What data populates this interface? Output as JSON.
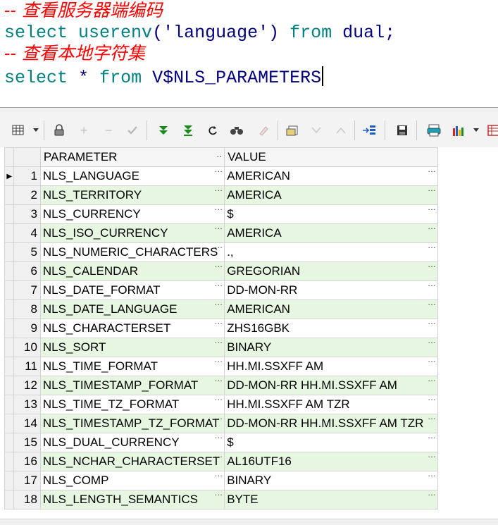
{
  "editor": {
    "comment1": "-- 查看服务器端编码",
    "line2": {
      "kw1": "select",
      "fn": "userenv",
      "arg": "'language'",
      "kw2": "from",
      "obj": "dual;"
    },
    "comment2": "-- 查看本地字符集",
    "line4": {
      "kw1": "select",
      "star": "*",
      "kw2": "from",
      "obj": "V$NLS_PARAMETERS"
    }
  },
  "toolbar": {
    "icons": [
      "grid-menu-icon",
      "lock-icon",
      "plus-icon",
      "minus-icon",
      "check-icon",
      "fetch-next-icon",
      "fetch-all-icon",
      "refresh-icon",
      "find-icon",
      "clear-icon",
      "query-by-example-icon",
      "filter-down-icon",
      "filter-up-icon",
      "export-icon",
      "save-icon",
      "print-icon",
      "chart-icon",
      "table-icon"
    ],
    "colors": {
      "green": "#1a8a1a",
      "blue": "#1f5fbf",
      "gray": "#b0b0b0"
    }
  },
  "grid": {
    "columns": [
      "PARAMETER",
      "VALUE"
    ],
    "rows": [
      {
        "n": "1",
        "param": "NLS_LANGUAGE",
        "value": "AMERICAN"
      },
      {
        "n": "2",
        "param": "NLS_TERRITORY",
        "value": "AMERICA"
      },
      {
        "n": "3",
        "param": "NLS_CURRENCY",
        "value": "$"
      },
      {
        "n": "4",
        "param": "NLS_ISO_CURRENCY",
        "value": "AMERICA"
      },
      {
        "n": "5",
        "param": "NLS_NUMERIC_CHARACTERS",
        "value": ".,"
      },
      {
        "n": "6",
        "param": "NLS_CALENDAR",
        "value": "GREGORIAN"
      },
      {
        "n": "7",
        "param": "NLS_DATE_FORMAT",
        "value": "DD-MON-RR"
      },
      {
        "n": "8",
        "param": "NLS_DATE_LANGUAGE",
        "value": "AMERICAN"
      },
      {
        "n": "9",
        "param": "NLS_CHARACTERSET",
        "value": "ZHS16GBK"
      },
      {
        "n": "10",
        "param": "NLS_SORT",
        "value": "BINARY"
      },
      {
        "n": "11",
        "param": "NLS_TIME_FORMAT",
        "value": "HH.MI.SSXFF AM"
      },
      {
        "n": "12",
        "param": "NLS_TIMESTAMP_FORMAT",
        "value": "DD-MON-RR HH.MI.SSXFF AM"
      },
      {
        "n": "13",
        "param": "NLS_TIME_TZ_FORMAT",
        "value": "HH.MI.SSXFF AM TZR"
      },
      {
        "n": "14",
        "param": "NLS_TIMESTAMP_TZ_FORMAT",
        "value": "DD-MON-RR HH.MI.SSXFF AM TZR"
      },
      {
        "n": "15",
        "param": "NLS_DUAL_CURRENCY",
        "value": "$"
      },
      {
        "n": "16",
        "param": "NLS_NCHAR_CHARACTERSET",
        "value": "AL16UTF16"
      },
      {
        "n": "17",
        "param": "NLS_COMP",
        "value": "BINARY"
      },
      {
        "n": "18",
        "param": "NLS_LENGTH_SEMANTICS",
        "value": "BYTE"
      }
    ],
    "colors": {
      "alt_row": "#e6f6e1"
    }
  }
}
